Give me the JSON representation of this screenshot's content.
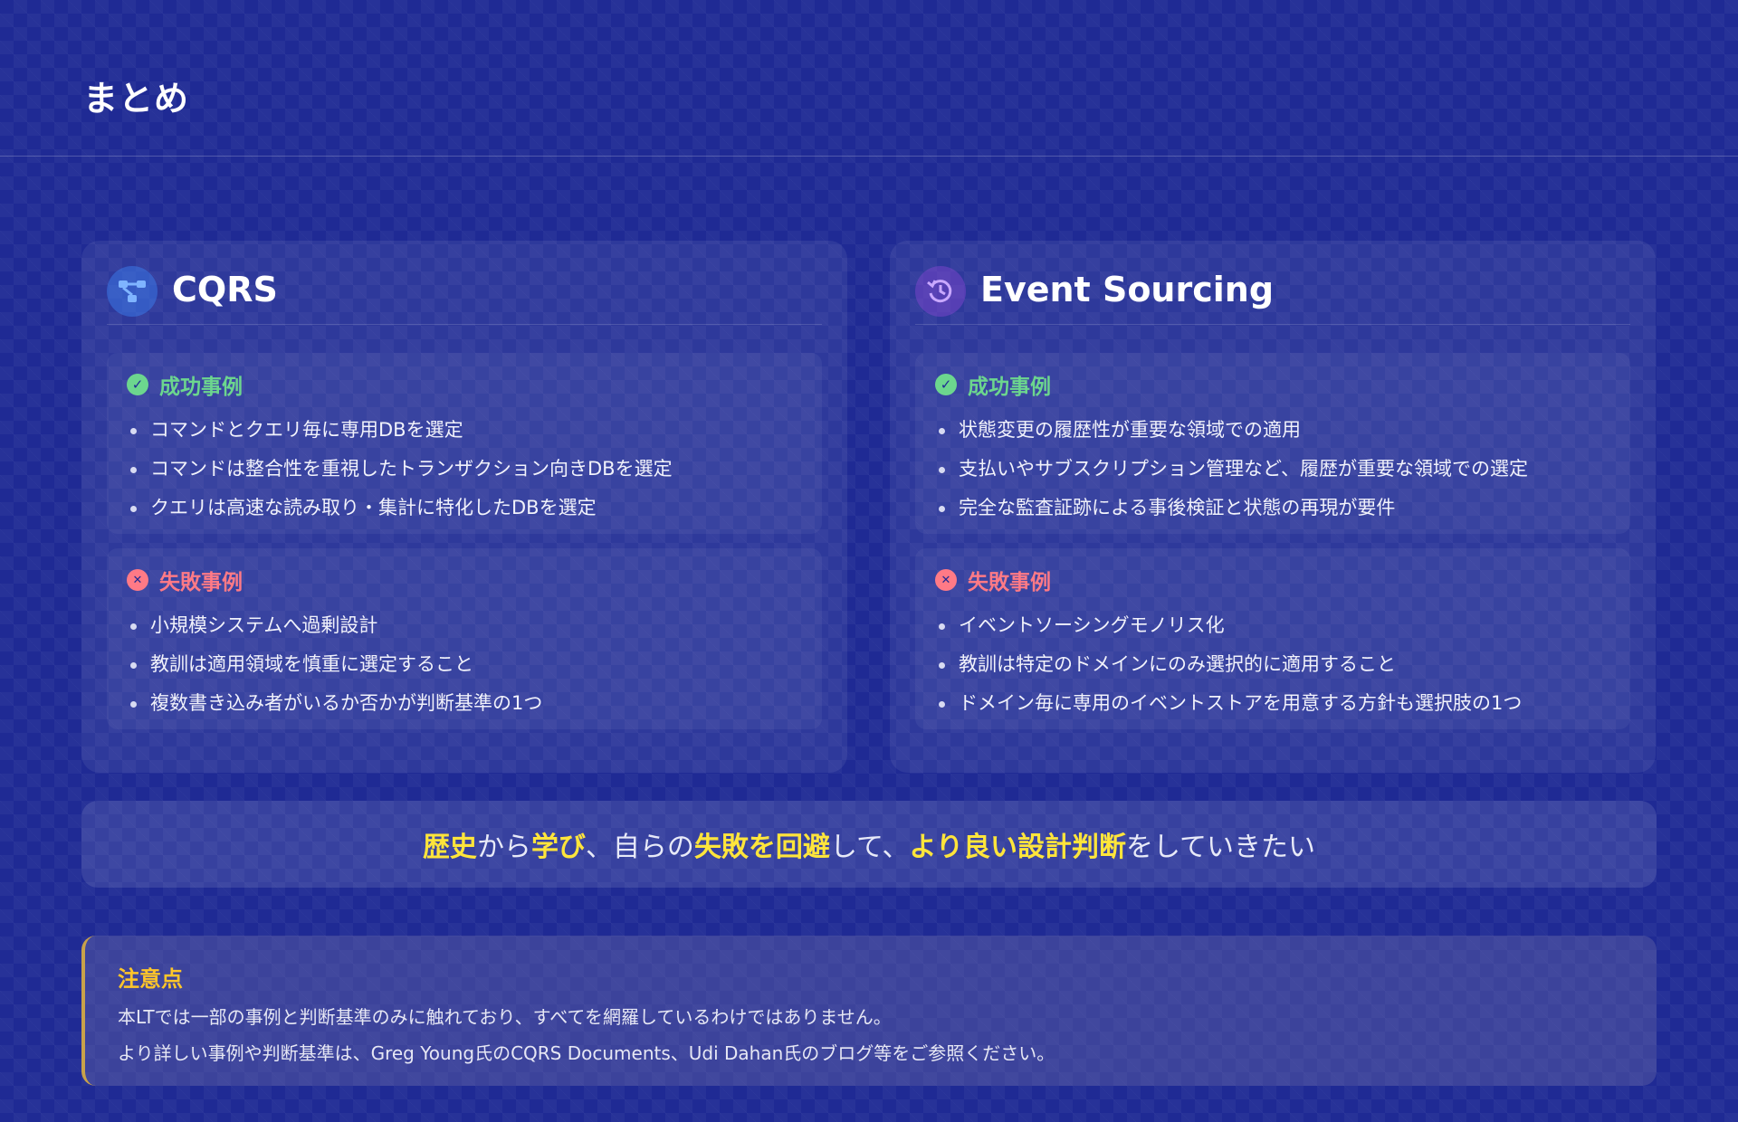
{
  "page": {
    "title": "まとめ"
  },
  "cards": [
    {
      "title": "CQRS",
      "icon": "diagram-flow-icon",
      "success": {
        "label": "成功事例",
        "items": [
          "コマンドとクエリ毎に専用DBを選定",
          "コマンドは整合性を重視したトランザクション向きDBを選定",
          "クエリは高速な読み取り・集計に特化したDBを選定"
        ]
      },
      "failure": {
        "label": "失敗事例",
        "items": [
          "小規模システムへ過剰設計",
          "教訓は適用領域を慎重に選定すること",
          "複数書き込み者がいるか否かが判断基準の1つ"
        ]
      }
    },
    {
      "title": "Event Sourcing",
      "icon": "history-icon",
      "success": {
        "label": "成功事例",
        "items": [
          "状態変更の履歴性が重要な領域での適用",
          "支払いやサブスクリプション管理など、履歴が重要な領域での選定",
          "完全な監査証跡による事後検証と状態の再現が要件"
        ]
      },
      "failure": {
        "label": "失敗事例",
        "items": [
          "イベントソーシングモノリス化",
          "教訓は特定のドメインにのみ選択的に適用すること",
          "ドメイン毎に専用のイベントストアを用意する方針も選択肢の1つ"
        ]
      }
    }
  ],
  "banner": {
    "parts": [
      "歴史",
      "から",
      "学び",
      "、自らの",
      "失敗を回避",
      "して、",
      "より良い設計判断",
      "をしていきたい"
    ]
  },
  "note": {
    "title": "注意点",
    "line1": "本LTでは一部の事例と判断基準のみに触れており、すべてを網羅しているわけではありません。",
    "line2": "より詳しい事例や判断基準は、Greg Young氏のCQRS Documents、Udi Dahan氏のブログ等をご参照ください。"
  },
  "colors": {
    "background": "#1f2a94",
    "success": "#6cd68e",
    "failure": "#ff7a86",
    "highlight": "#ffe53b",
    "note_title": "#ffc629"
  }
}
